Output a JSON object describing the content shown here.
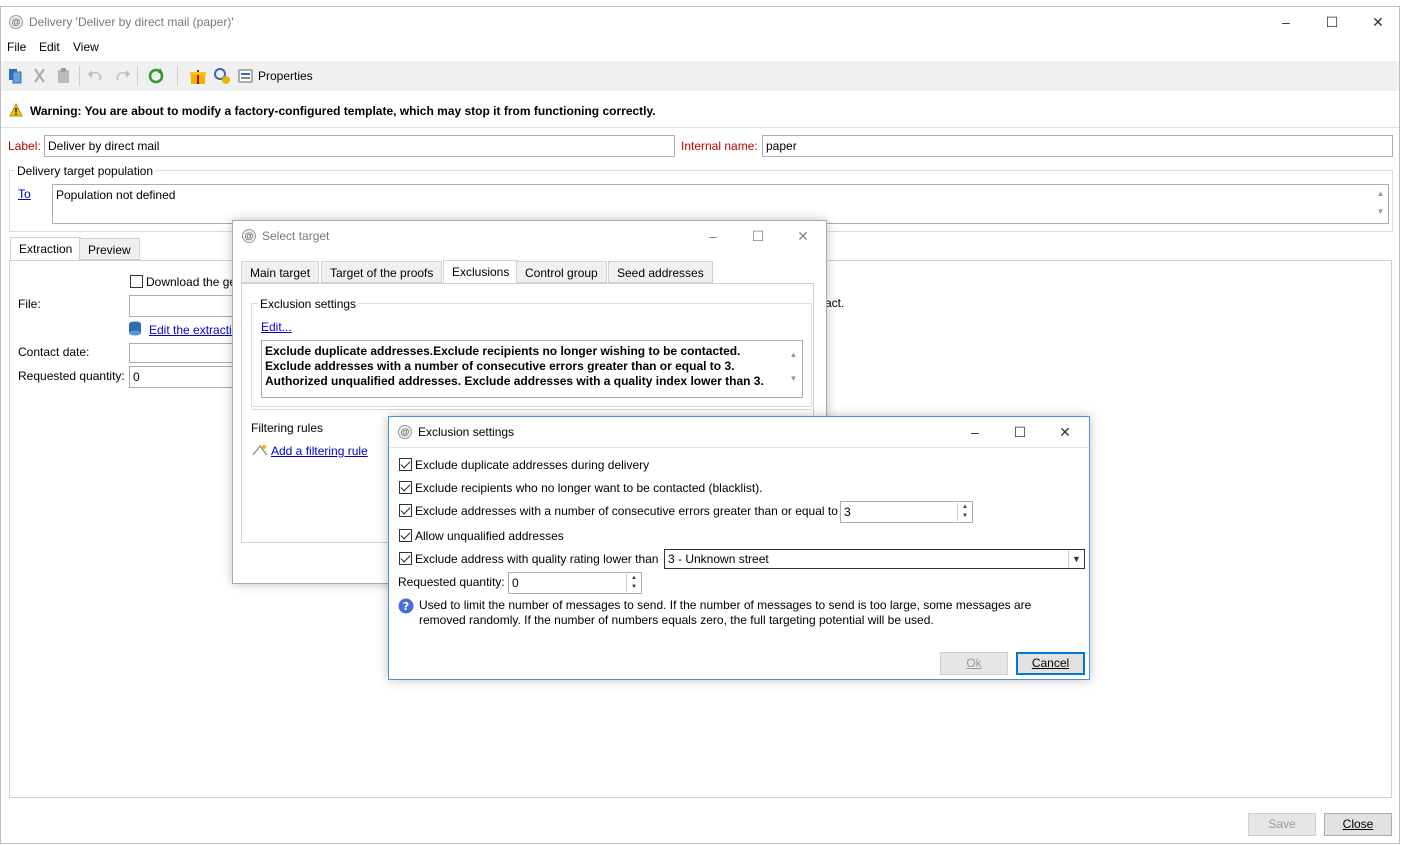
{
  "main": {
    "title": "Delivery 'Deliver by direct mail (paper)'",
    "menu": [
      "File",
      "Edit",
      "View"
    ],
    "toolbar": {
      "properties_label": "Properties"
    },
    "warning": "Warning: You are about to modify a factory-configured template, which may stop it from functioning correctly.",
    "label_caption": "Label:",
    "label_value": "Deliver by direct mail",
    "internal_name_caption": "Internal name:",
    "internal_name_value": "paper",
    "target_group_title": "Delivery target population",
    "to_link": "To",
    "population_text": "Population not defined",
    "tabs": [
      "Extraction",
      "Preview"
    ],
    "download_label": "Download the ge",
    "file_label": "File:",
    "edit_extraction_link": "Edit the extractio",
    "trailing_text": "act.",
    "contact_date_label": "Contact date:",
    "requested_quantity_label": "Requested quantity:",
    "requested_quantity_value": "0",
    "save_label": "Save",
    "close_label": "Close"
  },
  "select_target": {
    "title": "Select target",
    "tabs": [
      "Main target",
      "Target of the proofs",
      "Exclusions",
      "Control group",
      "Seed addresses"
    ],
    "exclusion_group_title": "Exclusion settings",
    "edit_link": "Edit...",
    "summary": "Exclude duplicate addresses.Exclude recipients no longer wishing to be contacted. Exclude addresses with a number of consecutive errors greater than or equal to 3. Authorized unqualified addresses. Exclude addresses with a quality index lower than 3.",
    "filtering_rules_title": "Filtering rules",
    "add_rule_link": "Add a filtering rule"
  },
  "exclusion_dialog": {
    "title": "Exclusion settings",
    "options": [
      {
        "label": "Exclude duplicate addresses during delivery",
        "checked": true
      },
      {
        "label": "Exclude recipients who no longer want to be contacted (blacklist).",
        "checked": true
      },
      {
        "label": "Exclude addresses with a number of consecutive errors greater than or equal to",
        "checked": true
      },
      {
        "label": "Allow unqualified addresses",
        "checked": true
      },
      {
        "label": "Exclude address with quality rating lower than",
        "checked": true
      }
    ],
    "errors_value": "3",
    "quality_value": "3 - Unknown street",
    "requested_quantity_label": "Requested quantity:",
    "requested_quantity_value": "0",
    "help_text": "Used to limit the number of messages to send. If the number of messages to send is too large, some messages are removed randomly. If the number of numbers equals zero, the full targeting potential will be used.",
    "ok_label": "Ok",
    "cancel_label": "Cancel"
  }
}
